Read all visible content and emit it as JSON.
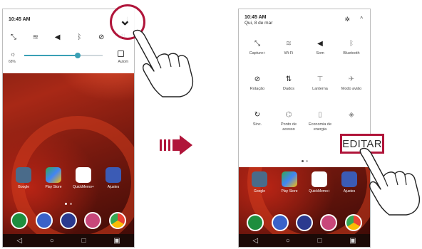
{
  "left_screen": {
    "status": {
      "time": "10:45 AM"
    },
    "quick_icons": [
      "capture",
      "wifi",
      "sound",
      "bluetooth",
      "rotation",
      "data"
    ],
    "brightness": {
      "percent_label": "68%",
      "level": 0.68,
      "auto_label": "Autom"
    },
    "apps": [
      {
        "label": "Google",
        "color": "#4a6b8a"
      },
      {
        "label": "Play Store",
        "color": "#3a8ad8"
      },
      {
        "label": "QuickMemo+",
        "color": "#ffffff"
      },
      {
        "label": "Ajustes",
        "color": "#3b5bb5"
      }
    ],
    "navbar": [
      "◁",
      "○",
      "□",
      "▣"
    ]
  },
  "right_screen": {
    "status": {
      "time": "10:45 AM",
      "date": "Qui, 8 de mar"
    },
    "tiles": [
      {
        "label": "Capture+",
        "icon": "capture-icon",
        "glyph": "⤡",
        "active": true
      },
      {
        "label": "Wi-Fi",
        "icon": "wifi-icon",
        "glyph": "≋",
        "active": false
      },
      {
        "label": "Som",
        "icon": "sound-icon",
        "glyph": "◀",
        "active": true
      },
      {
        "label": "Bluetooth",
        "icon": "bluetooth-icon",
        "glyph": "ᛒ",
        "active": false
      },
      {
        "label": "Rotação",
        "icon": "rotation-icon",
        "glyph": "⊘",
        "active": true
      },
      {
        "label": "Dados",
        "icon": "data-icon",
        "glyph": "⇅",
        "active": true
      },
      {
        "label": "Lanterna",
        "icon": "flashlight-icon",
        "glyph": "⊤",
        "active": false
      },
      {
        "label": "Modo avião",
        "icon": "airplane-icon",
        "glyph": "✈",
        "active": false
      },
      {
        "label": "Sinc.",
        "icon": "sync-icon",
        "glyph": "↻",
        "active": true
      },
      {
        "label": "Ponto de acesso",
        "icon": "hotspot-icon",
        "glyph": "⌬",
        "active": false
      },
      {
        "label": "Economia de energia",
        "icon": "battery-saver-icon",
        "glyph": "▯",
        "active": false
      },
      {
        "label": "",
        "icon": "nfc-icon",
        "glyph": "◈",
        "active": false
      }
    ],
    "edit_label": "EDITAR",
    "navbar": [
      "◁",
      "○",
      "□",
      "▣"
    ]
  },
  "colors": {
    "accent": "#b0153a",
    "slider": "#3aa0b5"
  }
}
